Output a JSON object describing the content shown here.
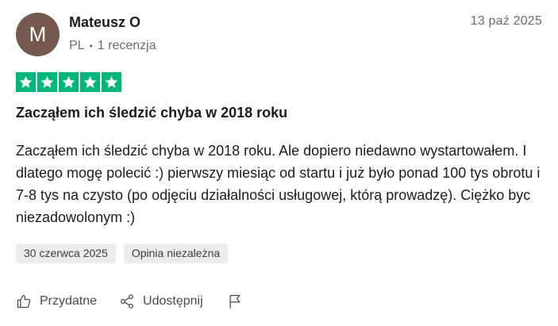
{
  "author": {
    "initial": "M",
    "name": "Mateusz O",
    "country": "PL",
    "separator": "•",
    "reviews_count": "1 recenzja",
    "avatar_color": "#75594e"
  },
  "review": {
    "date": "13 paź 2025",
    "rating": 5,
    "star_color": "#00b67a",
    "title": "Zacząłem ich śledzić chyba w 2018 roku",
    "body": "Zacząłem ich śledzić chyba w 2018 roku. Ale dopiero niedawno wystartowałem. I dlatego mogę polecić :) pierwszy miesiąc od startu i już było ponad 100 tys obrotu i 7-8 tys na czysto (po odjęciu działalności usługowej, którą prowadzę). Ciężko byc niezadowolonym :)",
    "experience_date": "30 czerwca 2025",
    "tag_label": "Opinia niezależna"
  },
  "actions": {
    "useful_label": "Przydatne",
    "useful_icon": "thumbs-up-icon",
    "share_label": "Udostępnij",
    "share_icon": "share-icon",
    "report_icon": "flag-icon"
  }
}
